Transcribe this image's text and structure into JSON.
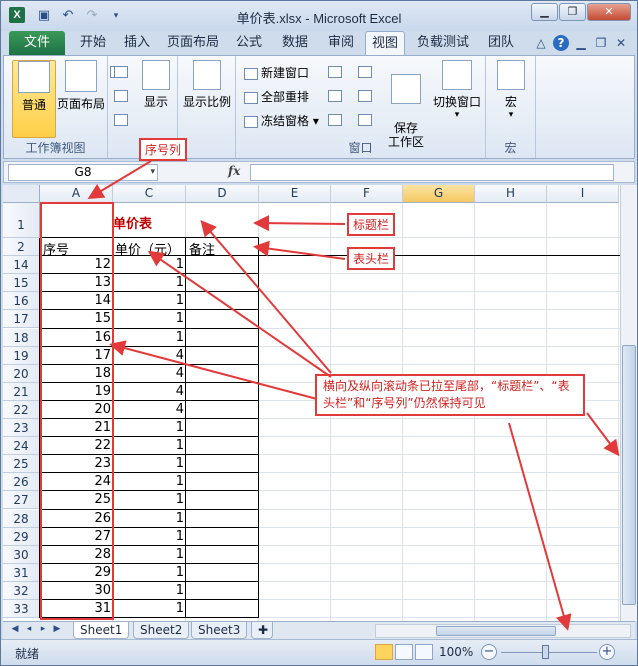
{
  "window": {
    "title": "单价表.xlsx - Microsoft Excel",
    "app_icon": "X"
  },
  "ribbon": {
    "tabs": [
      "文件",
      "开始",
      "插入",
      "页面布局",
      "公式",
      "数据",
      "审阅",
      "视图",
      "负载测试",
      "团队"
    ],
    "active_tab": "视图",
    "groups": {
      "workbook_views": {
        "label": "工作簿视图",
        "normal": "普通",
        "page_layout": "页面布局"
      },
      "show": {
        "label": "显示"
      },
      "zoom": {
        "label": "显示比例"
      },
      "window": {
        "label": "窗口",
        "new_window": "新建窗口",
        "arrange_all": "全部重排",
        "freeze_panes": "冻结窗格",
        "save_workspace": "保存\n工作区",
        "switch_windows": "切换窗口"
      },
      "macros": {
        "label": "宏",
        "macros": "宏"
      }
    }
  },
  "formula_bar": {
    "name_box": "G8",
    "fx": "fx",
    "value": ""
  },
  "sheet": {
    "columns": [
      "A",
      "C",
      "D",
      "E",
      "F",
      "G",
      "H",
      "I"
    ],
    "selected_column": "G",
    "title_cell": "单价表",
    "header_row": {
      "seq": "序号",
      "price": "单价（元）",
      "note": "备注"
    },
    "frozen_rows": [
      1,
      2
    ],
    "rows": [
      {
        "row": 14,
        "seq": 12,
        "price": 1
      },
      {
        "row": 15,
        "seq": 13,
        "price": 1
      },
      {
        "row": 16,
        "seq": 14,
        "price": 1
      },
      {
        "row": 17,
        "seq": 15,
        "price": 1
      },
      {
        "row": 18,
        "seq": 16,
        "price": 1
      },
      {
        "row": 19,
        "seq": 17,
        "price": 4
      },
      {
        "row": 20,
        "seq": 18,
        "price": 4
      },
      {
        "row": 21,
        "seq": 19,
        "price": 4
      },
      {
        "row": 22,
        "seq": 20,
        "price": 4
      },
      {
        "row": 23,
        "seq": 21,
        "price": 1
      },
      {
        "row": 24,
        "seq": 22,
        "price": 1
      },
      {
        "row": 25,
        "seq": 23,
        "price": 1
      },
      {
        "row": 26,
        "seq": 24,
        "price": 1
      },
      {
        "row": 27,
        "seq": 25,
        "price": 1
      },
      {
        "row": 28,
        "seq": 26,
        "price": 1
      },
      {
        "row": 29,
        "seq": 27,
        "price": 1
      },
      {
        "row": 30,
        "seq": 28,
        "price": 1
      },
      {
        "row": 31,
        "seq": 29,
        "price": 1
      },
      {
        "row": 32,
        "seq": 30,
        "price": 1
      },
      {
        "row": 33,
        "seq": 31,
        "price": 1
      }
    ]
  },
  "annotations": {
    "seq_col": "序号列",
    "title_bar": "标题栏",
    "header_bar": "表头栏",
    "note": "横向及纵向滚动条已拉至尾部，“标题栏”、“表头栏”和“序号列”仍然保持可见"
  },
  "sheet_tabs": [
    "Sheet1",
    "Sheet2",
    "Sheet3"
  ],
  "active_sheet": "Sheet1",
  "status": {
    "ready": "就绪",
    "zoom": "100%"
  },
  "colors": {
    "accent_red": "#e23a3a",
    "file_tab": "#1e7145",
    "title_red": "#c00000"
  }
}
